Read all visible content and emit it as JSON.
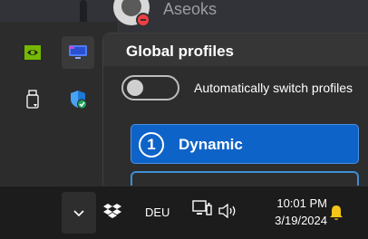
{
  "background_app": {
    "username": "Aseoks"
  },
  "panel": {
    "title": "Global profiles",
    "auto_switch_label": "Automatically switch profiles",
    "auto_switch_on": false,
    "profiles": [
      {
        "number": "1",
        "label": "Dynamic",
        "selected": true
      }
    ]
  },
  "taskbar": {
    "language": "DEU",
    "time": "10:01 PM",
    "date": "3/19/2024"
  },
  "icons": {
    "tray": [
      "nvidia-icon",
      "monitor-icon",
      "usb-eject-icon",
      "windows-security-icon"
    ],
    "taskbar": [
      "chevron-up-icon",
      "dropbox-icon",
      "network-icon",
      "volume-icon",
      "notification-bell-icon"
    ]
  },
  "colors": {
    "accent": "#0e63c8",
    "nvidia": "#76b900",
    "bell": "#f5c518",
    "dnd": "#f23f43"
  }
}
